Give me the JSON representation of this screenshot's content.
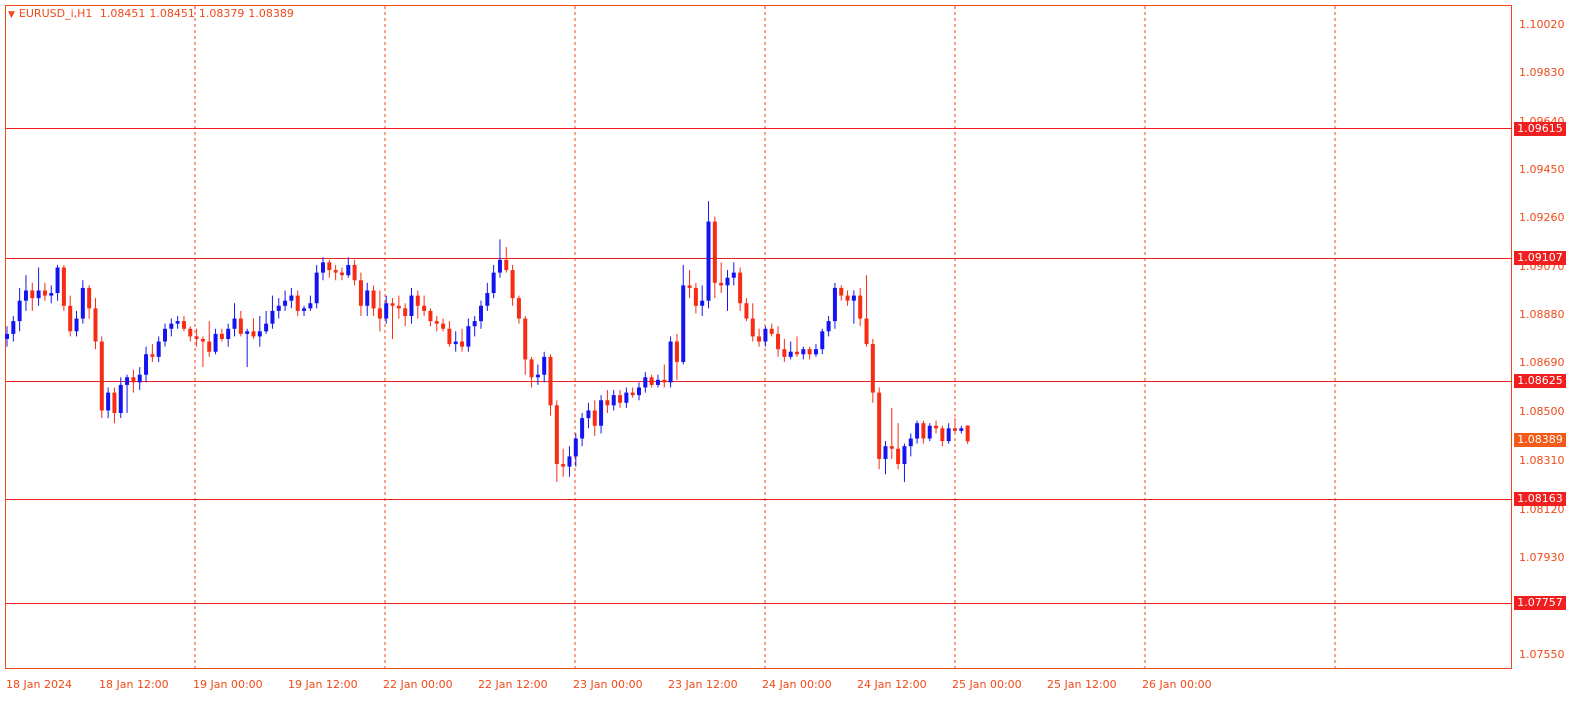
{
  "header": {
    "symbol": "EURUSD_i,H1",
    "open": "1.08451",
    "high": "1.08451",
    "low": "1.08379",
    "close": "1.08389"
  },
  "price_axis": [
    "1.10020",
    "1.09830",
    "1.09640",
    "1.09450",
    "1.09260",
    "1.09070",
    "1.08880",
    "1.08690",
    "1.08500",
    "1.08310",
    "1.08120",
    "1.07930",
    "1.07550"
  ],
  "levels": [
    "1.09615",
    "1.09107",
    "1.08625",
    "1.08163",
    "1.07757"
  ],
  "current_price": "1.08389",
  "time_axis": [
    "18 Jan 2024",
    "18 Jan 12:00",
    "19 Jan 00:00",
    "19 Jan 12:00",
    "22 Jan 00:00",
    "22 Jan 12:00",
    "23 Jan 00:00",
    "23 Jan 12:00",
    "24 Jan 00:00",
    "24 Jan 12:00",
    "25 Jan 00:00",
    "25 Jan 12:00",
    "26 Jan 00:00"
  ],
  "colors": {
    "bull": "#1414f0",
    "bear": "#f62c14",
    "level": "#f01e1e",
    "grid": "#f04a1a",
    "text": "#f04a1a"
  },
  "chart_data": {
    "type": "candlestick",
    "symbol": "EURUSD_i",
    "timeframe": "H1",
    "ylim": [
      1.0752,
      1.101
    ],
    "horizontal_levels": [
      1.09615,
      1.09107,
      1.08625,
      1.08163,
      1.07757
    ],
    "candles": [
      {
        "o": 1.0879,
        "h": 1.0884,
        "l": 1.0876,
        "c": 1.0881
      },
      {
        "o": 1.0881,
        "h": 1.0888,
        "l": 1.0878,
        "c": 1.0886
      },
      {
        "o": 1.0886,
        "h": 1.0899,
        "l": 1.0882,
        "c": 1.0894
      },
      {
        "o": 1.0894,
        "h": 1.0904,
        "l": 1.089,
        "c": 1.0898
      },
      {
        "o": 1.0898,
        "h": 1.0901,
        "l": 1.089,
        "c": 1.0895
      },
      {
        "o": 1.0895,
        "h": 1.0907,
        "l": 1.0892,
        "c": 1.0898
      },
      {
        "o": 1.0898,
        "h": 1.0901,
        "l": 1.0894,
        "c": 1.0896
      },
      {
        "o": 1.0896,
        "h": 1.09,
        "l": 1.0893,
        "c": 1.0897
      },
      {
        "o": 1.0897,
        "h": 1.0908,
        "l": 1.0894,
        "c": 1.0907
      },
      {
        "o": 1.0907,
        "h": 1.0908,
        "l": 1.089,
        "c": 1.0892
      },
      {
        "o": 1.0892,
        "h": 1.0896,
        "l": 1.088,
        "c": 1.0882
      },
      {
        "o": 1.0882,
        "h": 1.089,
        "l": 1.088,
        "c": 1.0887
      },
      {
        "o": 1.0887,
        "h": 1.0902,
        "l": 1.0885,
        "c": 1.0899
      },
      {
        "o": 1.0899,
        "h": 1.09,
        "l": 1.0887,
        "c": 1.0891
      },
      {
        "o": 1.0891,
        "h": 1.0895,
        "l": 1.0875,
        "c": 1.0878
      },
      {
        "o": 1.0878,
        "h": 1.088,
        "l": 1.0848,
        "c": 1.0851
      },
      {
        "o": 1.0851,
        "h": 1.086,
        "l": 1.0848,
        "c": 1.0858
      },
      {
        "o": 1.0858,
        "h": 1.086,
        "l": 1.0846,
        "c": 1.085
      },
      {
        "o": 1.085,
        "h": 1.0864,
        "l": 1.0848,
        "c": 1.0861
      },
      {
        "o": 1.0861,
        "h": 1.0865,
        "l": 1.085,
        "c": 1.0864
      },
      {
        "o": 1.0864,
        "h": 1.0867,
        "l": 1.0858,
        "c": 1.0862
      },
      {
        "o": 1.0862,
        "h": 1.0868,
        "l": 1.0859,
        "c": 1.0865
      },
      {
        "o": 1.0865,
        "h": 1.0876,
        "l": 1.0862,
        "c": 1.0873
      },
      {
        "o": 1.0873,
        "h": 1.0877,
        "l": 1.087,
        "c": 1.0872
      },
      {
        "o": 1.0872,
        "h": 1.088,
        "l": 1.087,
        "c": 1.0878
      },
      {
        "o": 1.0878,
        "h": 1.0885,
        "l": 1.0876,
        "c": 1.0883
      },
      {
        "o": 1.0883,
        "h": 1.0887,
        "l": 1.088,
        "c": 1.0885
      },
      {
        "o": 1.0885,
        "h": 1.0888,
        "l": 1.0883,
        "c": 1.0886
      },
      {
        "o": 1.0886,
        "h": 1.0888,
        "l": 1.0882,
        "c": 1.0883
      },
      {
        "o": 1.0883,
        "h": 1.0884,
        "l": 1.0878,
        "c": 1.088
      },
      {
        "o": 1.088,
        "h": 1.0883,
        "l": 1.0876,
        "c": 1.0879
      },
      {
        "o": 1.0879,
        "h": 1.088,
        "l": 1.0868,
        "c": 1.0878
      },
      {
        "o": 1.0878,
        "h": 1.0886,
        "l": 1.0872,
        "c": 1.0874
      },
      {
        "o": 1.0874,
        "h": 1.0883,
        "l": 1.0873,
        "c": 1.0881
      },
      {
        "o": 1.0881,
        "h": 1.0883,
        "l": 1.0878,
        "c": 1.0879
      },
      {
        "o": 1.0879,
        "h": 1.0885,
        "l": 1.0876,
        "c": 1.0883
      },
      {
        "o": 1.0883,
        "h": 1.0893,
        "l": 1.088,
        "c": 1.0887
      },
      {
        "o": 1.0887,
        "h": 1.089,
        "l": 1.088,
        "c": 1.0881
      },
      {
        "o": 1.0881,
        "h": 1.0883,
        "l": 1.0868,
        "c": 1.0882
      },
      {
        "o": 1.0882,
        "h": 1.0887,
        "l": 1.0879,
        "c": 1.088
      },
      {
        "o": 1.088,
        "h": 1.0888,
        "l": 1.0876,
        "c": 1.0882
      },
      {
        "o": 1.0882,
        "h": 1.089,
        "l": 1.0881,
        "c": 1.0885
      },
      {
        "o": 1.0885,
        "h": 1.0896,
        "l": 1.0883,
        "c": 1.089
      },
      {
        "o": 1.089,
        "h": 1.0895,
        "l": 1.0887,
        "c": 1.0892
      },
      {
        "o": 1.0892,
        "h": 1.0898,
        "l": 1.089,
        "c": 1.0894
      },
      {
        "o": 1.0894,
        "h": 1.0899,
        "l": 1.0891,
        "c": 1.0896
      },
      {
        "o": 1.0896,
        "h": 1.0898,
        "l": 1.0888,
        "c": 1.089
      },
      {
        "o": 1.089,
        "h": 1.0892,
        "l": 1.0888,
        "c": 1.0891
      },
      {
        "o": 1.0891,
        "h": 1.0896,
        "l": 1.089,
        "c": 1.0893
      },
      {
        "o": 1.0893,
        "h": 1.0908,
        "l": 1.0891,
        "c": 1.0905
      },
      {
        "o": 1.0905,
        "h": 1.0911,
        "l": 1.0902,
        "c": 1.0909
      },
      {
        "o": 1.0909,
        "h": 1.091,
        "l": 1.0903,
        "c": 1.0906
      },
      {
        "o": 1.0906,
        "h": 1.0908,
        "l": 1.0902,
        "c": 1.0905
      },
      {
        "o": 1.0905,
        "h": 1.0907,
        "l": 1.0902,
        "c": 1.0904
      },
      {
        "o": 1.0904,
        "h": 1.0911,
        "l": 1.0903,
        "c": 1.0908
      },
      {
        "o": 1.0908,
        "h": 1.091,
        "l": 1.09,
        "c": 1.0902
      },
      {
        "o": 1.0902,
        "h": 1.0905,
        "l": 1.0888,
        "c": 1.0892
      },
      {
        "o": 1.0892,
        "h": 1.0901,
        "l": 1.0888,
        "c": 1.0898
      },
      {
        "o": 1.0898,
        "h": 1.09,
        "l": 1.0888,
        "c": 1.0891
      },
      {
        "o": 1.0891,
        "h": 1.0898,
        "l": 1.0882,
        "c": 1.0887
      },
      {
        "o": 1.0887,
        "h": 1.0896,
        "l": 1.0885,
        "c": 1.0893
      },
      {
        "o": 1.0893,
        "h": 1.0895,
        "l": 1.0879,
        "c": 1.0892
      },
      {
        "o": 1.0892,
        "h": 1.0896,
        "l": 1.0887,
        "c": 1.0891
      },
      {
        "o": 1.0891,
        "h": 1.0893,
        "l": 1.0884,
        "c": 1.0888
      },
      {
        "o": 1.0888,
        "h": 1.0899,
        "l": 1.0885,
        "c": 1.0896
      },
      {
        "o": 1.0896,
        "h": 1.0898,
        "l": 1.0887,
        "c": 1.0892
      },
      {
        "o": 1.0892,
        "h": 1.0896,
        "l": 1.0888,
        "c": 1.089
      },
      {
        "o": 1.089,
        "h": 1.0891,
        "l": 1.0884,
        "c": 1.0886
      },
      {
        "o": 1.0886,
        "h": 1.0888,
        "l": 1.0882,
        "c": 1.0885
      },
      {
        "o": 1.0885,
        "h": 1.0887,
        "l": 1.0882,
        "c": 1.0883
      },
      {
        "o": 1.0883,
        "h": 1.0886,
        "l": 1.0876,
        "c": 1.0877
      },
      {
        "o": 1.0877,
        "h": 1.0882,
        "l": 1.0874,
        "c": 1.0878
      },
      {
        "o": 1.0878,
        "h": 1.0883,
        "l": 1.0874,
        "c": 1.0876
      },
      {
        "o": 1.0876,
        "h": 1.0887,
        "l": 1.0874,
        "c": 1.0884
      },
      {
        "o": 1.0884,
        "h": 1.0888,
        "l": 1.088,
        "c": 1.0886
      },
      {
        "o": 1.0886,
        "h": 1.0894,
        "l": 1.0883,
        "c": 1.0892
      },
      {
        "o": 1.0892,
        "h": 1.0901,
        "l": 1.089,
        "c": 1.0897
      },
      {
        "o": 1.0897,
        "h": 1.0908,
        "l": 1.0895,
        "c": 1.0905
      },
      {
        "o": 1.0905,
        "h": 1.0918,
        "l": 1.0903,
        "c": 1.091
      },
      {
        "o": 1.091,
        "h": 1.0915,
        "l": 1.0905,
        "c": 1.0906
      },
      {
        "o": 1.0906,
        "h": 1.0908,
        "l": 1.0892,
        "c": 1.0895
      },
      {
        "o": 1.0895,
        "h": 1.0896,
        "l": 1.0885,
        "c": 1.0887
      },
      {
        "o": 1.0887,
        "h": 1.0888,
        "l": 1.0865,
        "c": 1.0871
      },
      {
        "o": 1.0871,
        "h": 1.0872,
        "l": 1.086,
        "c": 1.0864
      },
      {
        "o": 1.0864,
        "h": 1.0869,
        "l": 1.0861,
        "c": 1.0865
      },
      {
        "o": 1.0865,
        "h": 1.0874,
        "l": 1.0862,
        "c": 1.0872
      },
      {
        "o": 1.0872,
        "h": 1.0873,
        "l": 1.0849,
        "c": 1.0853
      },
      {
        "o": 1.0853,
        "h": 1.0855,
        "l": 1.0823,
        "c": 1.083
      },
      {
        "o": 1.083,
        "h": 1.0836,
        "l": 1.0825,
        "c": 1.0829
      },
      {
        "o": 1.0829,
        "h": 1.0837,
        "l": 1.0825,
        "c": 1.0833
      },
      {
        "o": 1.0833,
        "h": 1.0842,
        "l": 1.0829,
        "c": 1.084
      },
      {
        "o": 1.084,
        "h": 1.085,
        "l": 1.0837,
        "c": 1.0848
      },
      {
        "o": 1.0848,
        "h": 1.0854,
        "l": 1.0844,
        "c": 1.0851
      },
      {
        "o": 1.0851,
        "h": 1.0855,
        "l": 1.0841,
        "c": 1.0845
      },
      {
        "o": 1.0845,
        "h": 1.0857,
        "l": 1.0842,
        "c": 1.0855
      },
      {
        "o": 1.0855,
        "h": 1.0859,
        "l": 1.085,
        "c": 1.0853
      },
      {
        "o": 1.0853,
        "h": 1.0859,
        "l": 1.0851,
        "c": 1.0857
      },
      {
        "o": 1.0857,
        "h": 1.0859,
        "l": 1.0852,
        "c": 1.0854
      },
      {
        "o": 1.0854,
        "h": 1.086,
        "l": 1.0852,
        "c": 1.0858
      },
      {
        "o": 1.0858,
        "h": 1.086,
        "l": 1.0856,
        "c": 1.0857
      },
      {
        "o": 1.0857,
        "h": 1.0862,
        "l": 1.0855,
        "c": 1.086
      },
      {
        "o": 1.086,
        "h": 1.0866,
        "l": 1.0858,
        "c": 1.0864
      },
      {
        "o": 1.0864,
        "h": 1.0865,
        "l": 1.086,
        "c": 1.0861
      },
      {
        "o": 1.0861,
        "h": 1.0865,
        "l": 1.086,
        "c": 1.0863
      },
      {
        "o": 1.0863,
        "h": 1.0869,
        "l": 1.086,
        "c": 1.0862
      },
      {
        "o": 1.0862,
        "h": 1.088,
        "l": 1.086,
        "c": 1.0878
      },
      {
        "o": 1.0878,
        "h": 1.0881,
        "l": 1.0863,
        "c": 1.087
      },
      {
        "o": 1.087,
        "h": 1.0908,
        "l": 1.0869,
        "c": 1.09
      },
      {
        "o": 1.09,
        "h": 1.0906,
        "l": 1.0895,
        "c": 1.0899
      },
      {
        "o": 1.0899,
        "h": 1.0901,
        "l": 1.0889,
        "c": 1.0892
      },
      {
        "o": 1.0892,
        "h": 1.09,
        "l": 1.0888,
        "c": 1.0894
      },
      {
        "o": 1.0894,
        "h": 1.0933,
        "l": 1.0891,
        "c": 1.0925
      },
      {
        "o": 1.0925,
        "h": 1.0927,
        "l": 1.0895,
        "c": 1.0901
      },
      {
        "o": 1.0901,
        "h": 1.0909,
        "l": 1.0897,
        "c": 1.09
      },
      {
        "o": 1.09,
        "h": 1.0906,
        "l": 1.089,
        "c": 1.0903
      },
      {
        "o": 1.0903,
        "h": 1.0909,
        "l": 1.09,
        "c": 1.0905
      },
      {
        "o": 1.0905,
        "h": 1.0907,
        "l": 1.089,
        "c": 1.0893
      },
      {
        "o": 1.0893,
        "h": 1.0895,
        "l": 1.0886,
        "c": 1.0887
      },
      {
        "o": 1.0887,
        "h": 1.0893,
        "l": 1.0878,
        "c": 1.088
      },
      {
        "o": 1.088,
        "h": 1.0883,
        "l": 1.0876,
        "c": 1.0878
      },
      {
        "o": 1.0878,
        "h": 1.0884,
        "l": 1.0876,
        "c": 1.0883
      },
      {
        "o": 1.0883,
        "h": 1.0885,
        "l": 1.088,
        "c": 1.0881
      },
      {
        "o": 1.0881,
        "h": 1.0884,
        "l": 1.0872,
        "c": 1.0875
      },
      {
        "o": 1.0875,
        "h": 1.0879,
        "l": 1.087,
        "c": 1.0872
      },
      {
        "o": 1.0872,
        "h": 1.0878,
        "l": 1.0871,
        "c": 1.0874
      },
      {
        "o": 1.0874,
        "h": 1.088,
        "l": 1.0872,
        "c": 1.0873
      },
      {
        "o": 1.0873,
        "h": 1.0876,
        "l": 1.0871,
        "c": 1.0875
      },
      {
        "o": 1.0875,
        "h": 1.0876,
        "l": 1.0871,
        "c": 1.0873
      },
      {
        "o": 1.0873,
        "h": 1.0877,
        "l": 1.0872,
        "c": 1.0875
      },
      {
        "o": 1.0875,
        "h": 1.0883,
        "l": 1.0873,
        "c": 1.0882
      },
      {
        "o": 1.0882,
        "h": 1.0888,
        "l": 1.088,
        "c": 1.0886
      },
      {
        "o": 1.0886,
        "h": 1.0901,
        "l": 1.0883,
        "c": 1.0899
      },
      {
        "o": 1.0899,
        "h": 1.09,
        "l": 1.0894,
        "c": 1.0896
      },
      {
        "o": 1.0896,
        "h": 1.0898,
        "l": 1.0892,
        "c": 1.0894
      },
      {
        "o": 1.0894,
        "h": 1.0898,
        "l": 1.0885,
        "c": 1.0896
      },
      {
        "o": 1.0896,
        "h": 1.0899,
        "l": 1.0884,
        "c": 1.0887
      },
      {
        "o": 1.0887,
        "h": 1.0904,
        "l": 1.0876,
        "c": 1.0877
      },
      {
        "o": 1.0877,
        "h": 1.0879,
        "l": 1.0854,
        "c": 1.0858
      },
      {
        "o": 1.0858,
        "h": 1.086,
        "l": 1.0828,
        "c": 1.0832
      },
      {
        "o": 1.0832,
        "h": 1.0839,
        "l": 1.0826,
        "c": 1.0837
      },
      {
        "o": 1.0837,
        "h": 1.0852,
        "l": 1.0832,
        "c": 1.0836
      },
      {
        "o": 1.0836,
        "h": 1.0846,
        "l": 1.0828,
        "c": 1.083
      },
      {
        "o": 1.083,
        "h": 1.0838,
        "l": 1.0823,
        "c": 1.0837
      },
      {
        "o": 1.0837,
        "h": 1.0842,
        "l": 1.0833,
        "c": 1.084
      },
      {
        "o": 1.084,
        "h": 1.0847,
        "l": 1.0838,
        "c": 1.0846
      },
      {
        "o": 1.0846,
        "h": 1.0847,
        "l": 1.0838,
        "c": 1.084
      },
      {
        "o": 1.084,
        "h": 1.0846,
        "l": 1.0839,
        "c": 1.0845
      },
      {
        "o": 1.0845,
        "h": 1.0847,
        "l": 1.0842,
        "c": 1.0844
      },
      {
        "o": 1.0844,
        "h": 1.0845,
        "l": 1.0837,
        "c": 1.0839
      },
      {
        "o": 1.0839,
        "h": 1.0846,
        "l": 1.0838,
        "c": 1.0844
      },
      {
        "o": 1.0844,
        "h": 1.0848,
        "l": 1.0842,
        "c": 1.0843
      },
      {
        "o": 1.0843,
        "h": 1.0845,
        "l": 1.0842,
        "c": 1.0844
      },
      {
        "o": 1.08451,
        "h": 1.08451,
        "l": 1.08379,
        "c": 1.08389
      }
    ]
  }
}
